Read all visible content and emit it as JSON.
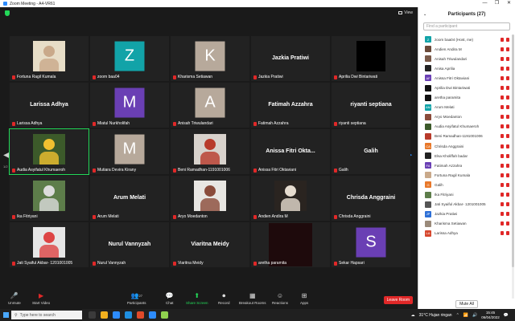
{
  "window": {
    "title": "Zoom Meeting - A4-VR61",
    "controls": [
      "—",
      "❐",
      "✕"
    ]
  },
  "topbar": {
    "view_label": "View"
  },
  "pagination": {
    "left_page": "1/2",
    "right_page": "1/2"
  },
  "tiles": [
    {
      "label": "Fortuna Ragil Kumala",
      "kind": "photo",
      "photo_bg": "#e7ddc7",
      "photo_fg": "#c9a98a"
    },
    {
      "label": "zoom baa04",
      "kind": "avatar",
      "letter": "Z",
      "color": "#12a3a8"
    },
    {
      "label": "Kharisma Setiawan",
      "kind": "avatar",
      "letter": "K",
      "color": "#b7a99b"
    },
    {
      "label": "Jazkia Pratiwi",
      "kind": "name",
      "big": "Jazkia Pratiwi"
    },
    {
      "label": "Aprilia Dwi Bintariwati",
      "kind": "black"
    },
    {
      "label": "Larissa Adhya",
      "kind": "name",
      "big": "Larissa Adhya"
    },
    {
      "label": "Miatul Nurkholifah",
      "kind": "avatar",
      "letter": "M",
      "color": "#6a3fb4"
    },
    {
      "label": "Anisah Triwulandari",
      "kind": "avatar",
      "letter": "A",
      "color": "#b7a99b"
    },
    {
      "label": "Fatimah Azzahra",
      "kind": "name",
      "big": "Fatimah Azzahra"
    },
    {
      "label": "riyanti septiana",
      "kind": "name",
      "big": "riyanti septiana"
    },
    {
      "label": "Audia Asyifatul Khumaeroh",
      "kind": "photo",
      "photo_bg": "#3c5a2a",
      "photo_fg": "#f0c030",
      "active": true
    },
    {
      "label": "Mutiara Devira Kirany",
      "kind": "avatar",
      "letter": "M",
      "color": "#b7a99b"
    },
    {
      "label": "Beni Ramadhan-1191001006",
      "kind": "photo",
      "photo_bg": "#d8d2cc",
      "photo_fg": "#b83a2a"
    },
    {
      "label": "Anissa Fitri Oktaviani",
      "kind": "name",
      "big": "Anissa Fitri Okta..."
    },
    {
      "label": "Galih",
      "kind": "name",
      "big": "Galih"
    },
    {
      "label": "Ika Fitriyani",
      "kind": "photo",
      "photo_bg": "#5d7d4a",
      "photo_fg": "#dcdcdc"
    },
    {
      "label": "Arum Melati",
      "kind": "name",
      "big": "Arum Melati"
    },
    {
      "label": "Aryo Moedanton",
      "kind": "photo",
      "photo_bg": "#e8e6e2",
      "photo_fg": "#8a4b3a"
    },
    {
      "label": "Andien Andira M",
      "kind": "photo",
      "photo_bg": "#2a2420",
      "photo_fg": "#e6dccf"
    },
    {
      "label": "Chrisda Anggraini",
      "kind": "name",
      "big": "Chrisda Anggraini"
    },
    {
      "label": "Jati Syaiful Akbar- 1201001005",
      "kind": "photo",
      "photo_bg": "#e6e6e6",
      "photo_fg": "#d44"
    },
    {
      "label": "Nurul Vannyzah",
      "kind": "name",
      "big": "Nurul Vannyzah"
    },
    {
      "label": "Viaritna Meidy",
      "kind": "name",
      "big": "Viaritna Meidy"
    },
    {
      "label": "aretha paramita",
      "kind": "darkred"
    },
    {
      "label": "Sekar Hapsari",
      "kind": "avatar",
      "letter": "S",
      "color": "#6a3fb4"
    }
  ],
  "toolbar": {
    "unmute": "Unmute",
    "start_video": "Start Video",
    "participants": "Participants",
    "participants_count": "27",
    "chat": "Chat",
    "share_screen": "Share Screen",
    "record": "Record",
    "breakout_rooms": "Breakout Rooms",
    "reactions": "Reactions",
    "apps": "Apps",
    "leave": "Leave Room"
  },
  "panel": {
    "title": "Participants (27)",
    "search_placeholder": "Find a participant",
    "mute_all": "Mute All",
    "participants": [
      {
        "name": "zoom baa04 (Host, me)",
        "initial": "Z",
        "color": "#12a3a8"
      },
      {
        "name": "Andien Andira M",
        "initial": "",
        "color": "#6b4a3a"
      },
      {
        "name": "Anisah Triwulandari",
        "initial": "",
        "color": "#7a5a4a"
      },
      {
        "name": "Anisa Aprilia",
        "initial": "",
        "color": "#222222"
      },
      {
        "name": "Anissa Fitri Oktaviani",
        "initial": "AF",
        "color": "#6a3fb4"
      },
      {
        "name": "Aprilia Dwi Bintariwati",
        "initial": "",
        "color": "#111111"
      },
      {
        "name": "aretha paramita",
        "initial": "",
        "color": "#111111"
      },
      {
        "name": "Arum Melati",
        "initial": "AM",
        "color": "#12a3a8"
      },
      {
        "name": "Aryo Moedanton",
        "initial": "",
        "color": "#8a4b3a"
      },
      {
        "name": "Audia Asyifatul Khumaeroh",
        "initial": "",
        "color": "#3c5a2a"
      },
      {
        "name": "Beni Ramadhan-1191001006",
        "initial": "",
        "color": "#b83a2a"
      },
      {
        "name": "Chrisda Anggraini",
        "initial": "CA",
        "color": "#e8782a"
      },
      {
        "name": "Elsa Kholiffah badar",
        "initial": "",
        "color": "#222222"
      },
      {
        "name": "Fatimah Azzahra",
        "initial": "FA",
        "color": "#6a3fb4"
      },
      {
        "name": "Fortuna Ragil Kumala",
        "initial": "",
        "color": "#c9a98a"
      },
      {
        "name": "Galih",
        "initial": "G",
        "color": "#e8782a"
      },
      {
        "name": "Ika Fitriyani",
        "initial": "",
        "color": "#5d7d4a"
      },
      {
        "name": "Jati Syaiful Akbar- 1201001005",
        "initial": "",
        "color": "#555555"
      },
      {
        "name": "Jazkia Pratiwi",
        "initial": "JP",
        "color": "#2d6fd6"
      },
      {
        "name": "Kharisma Setiawan",
        "initial": "",
        "color": "#9a8a7a"
      },
      {
        "name": "Larissa Adhya",
        "initial": "LA",
        "color": "#d6472d"
      }
    ]
  },
  "taskbar": {
    "search_placeholder": "Type here to search",
    "weather": "31°C  Hujan ringan",
    "time": "15:45",
    "date": "06/04/2022",
    "app_colors": [
      "#3b3b3b",
      "#f2b01e",
      "#2d8cff",
      "#1f8fe0",
      "#e04a2a",
      "#2d8cff",
      "#8fd14f"
    ]
  }
}
